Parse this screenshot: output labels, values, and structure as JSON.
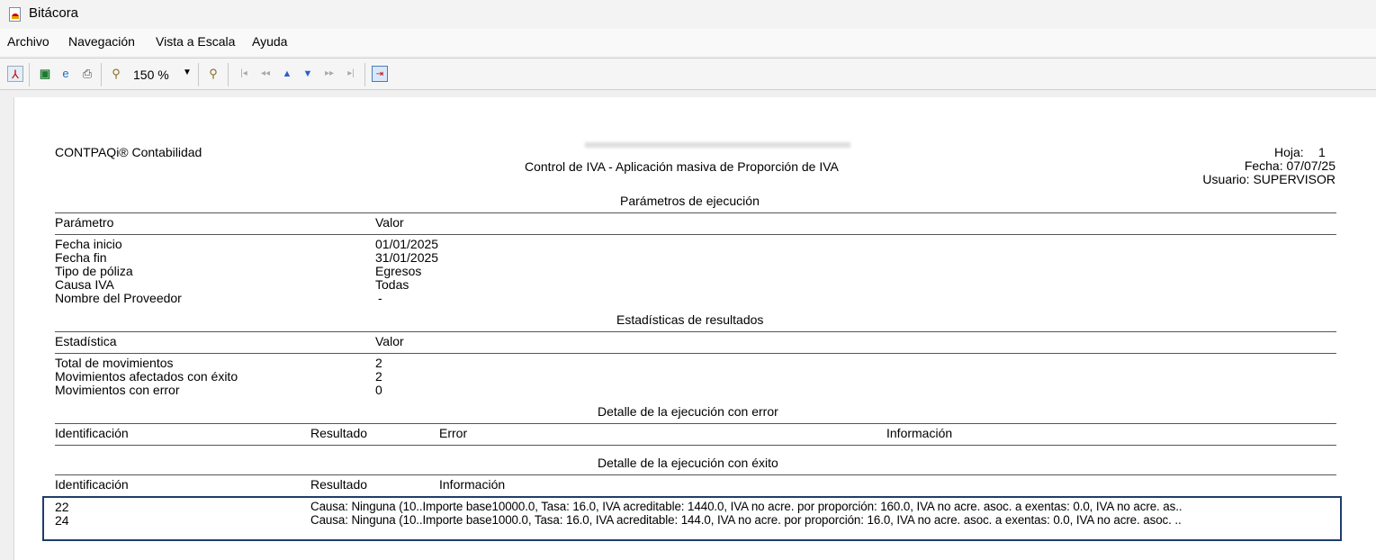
{
  "window": {
    "title": "Bitácora"
  },
  "menu": [
    "Archivo",
    "Navegación",
    "Vista a Escala",
    "Ayuda"
  ],
  "toolbar": {
    "zoom": "150 %"
  },
  "report": {
    "company": "CONTPAQi® Contabilidad",
    "title": "Control de IVA - Aplicación masiva de Proporción de IVA",
    "hoja_label": "Hoja:",
    "hoja": "1",
    "fecha": "Fecha: 07/07/25",
    "usuario": "Usuario: SUPERVISOR",
    "params": {
      "heading": "Parámetros de ejecución",
      "col1": "Parámetro",
      "col2": "Valor",
      "rows": [
        [
          "Fecha inicio",
          "01/01/2025"
        ],
        [
          "Fecha fin",
          "31/01/2025"
        ],
        [
          "Tipo de póliza",
          "Egresos"
        ],
        [
          "Causa IVA",
          "Todas"
        ],
        [
          "Nombre del Proveedor",
          "-"
        ]
      ]
    },
    "stats": {
      "heading": "Estadísticas de resultados",
      "col1": "Estadística",
      "col2": "Valor",
      "rows": [
        [
          "Total de movimientos",
          "2"
        ],
        [
          "Movimientos afectados con éxito",
          "2"
        ],
        [
          "Movimientos con error",
          "0"
        ]
      ]
    },
    "errors": {
      "heading": "Detalle de la ejecución con error",
      "cols": [
        "Identificación",
        "Resultado",
        "Error",
        "Información"
      ]
    },
    "success": {
      "heading": "Detalle de la ejecución con éxito",
      "cols": [
        "Identificación",
        "Resultado",
        "Información"
      ],
      "rows": [
        [
          "22",
          "Causa: Ninguna (10..Importe base10000.0,  Tasa: 16.0,  IVA acreditable: 1440.0,  IVA no acre. por proporción: 160.0,  IVA no acre. asoc. a exentas: 0.0,  IVA no acre. as.."
        ],
        [
          "24",
          "Causa: Ninguna (10..Importe base1000.0,  Tasa: 16.0,  IVA acreditable: 144.0,  IVA no acre. por proporción: 16.0,  IVA no acre. asoc. a exentas: 0.0,  IVA no acre. asoc. .."
        ]
      ]
    }
  }
}
